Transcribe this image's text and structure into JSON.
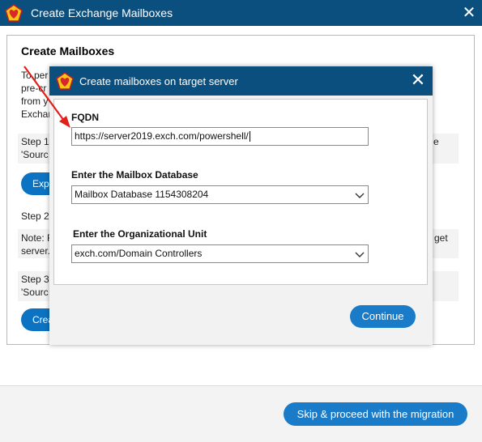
{
  "window": {
    "title": "Create Exchange Mailboxes",
    "close_glyph": "✕"
  },
  "panel": {
    "heading": "Create Mailboxes",
    "intro_lines": [
      "To per",
      "pre-cr",
      "from y",
      "Exchar"
    ],
    "step1_lines": [
      "Step 1:",
      "'Sourc"
    ],
    "step1_right": "e",
    "export_button": "Expo",
    "step2": "Step 2:",
    "note_lines": [
      "Note: F",
      "server."
    ],
    "note_right": "get",
    "step3_lines": [
      "Step 3:",
      "'Sourc"
    ],
    "create_button": "Crea"
  },
  "footer": {
    "skip_button": "Skip & proceed with the migration"
  },
  "dialog": {
    "title": "Create mailboxes on target server",
    "close_glyph": "✕",
    "fqdn_label": "FQDN",
    "fqdn_value": "https://server2019.exch.com/powershell/",
    "mailbox_db_label": "Enter the Mailbox Database",
    "mailbox_db_value": "Mailbox Database 1154308204",
    "ou_label": "Enter the Organizational Unit",
    "ou_value": "exch.com/Domain Controllers",
    "continue_button": "Continue"
  },
  "colors": {
    "titlebar": "#0b4f7e",
    "accent_button": "#1a7cc9",
    "annotation_arrow": "#e0201b"
  },
  "icons": [
    "app-logo-icon",
    "close-icon",
    "chevron-down-icon",
    "annotation-arrow-icon"
  ]
}
